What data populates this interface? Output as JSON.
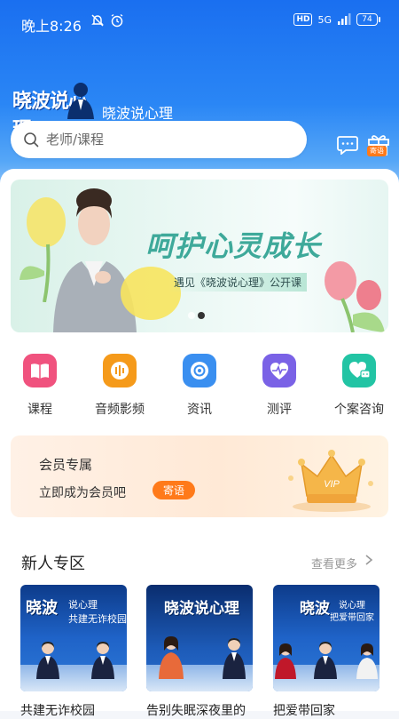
{
  "status_bar": {
    "time": "晚上8:26",
    "hd": "HD",
    "signal": "5G",
    "battery": "74"
  },
  "brand": {
    "logo_text": "晓波说心理",
    "name": "晓波说心理"
  },
  "search": {
    "placeholder": "老师/课程"
  },
  "header_icons": {
    "gift_tag": "寄语"
  },
  "banner": {
    "title": "呵护心灵成长",
    "subtitle": "遇见《晓波说心理》公开课",
    "dot_count": 2,
    "active_index": 1
  },
  "categories": [
    {
      "label": "课程",
      "icon": "book-icon",
      "color": "#f0527e"
    },
    {
      "label": "音频影频",
      "icon": "audio-icon",
      "color": "#f59a1a"
    },
    {
      "label": "资讯",
      "icon": "camera-icon",
      "color": "#3a8ff0"
    },
    {
      "label": "测评",
      "icon": "heart-pulse-icon",
      "color": "#7a62e6"
    },
    {
      "label": "个案咨询",
      "icon": "heart-chat-icon",
      "color": "#22c4a4"
    }
  ],
  "member": {
    "title": "会员专属",
    "subtitle": "立即成为会员吧",
    "button": "寄语",
    "badge": "VIP"
  },
  "new_user": {
    "title": "新人专区",
    "more": "查看更多",
    "videos": [
      {
        "caption": "共建无诈校园",
        "title": "晓波",
        "sub1": "说心理",
        "sub2": "共建无诈校园"
      },
      {
        "caption": "告别失眠深夜里的",
        "title": "晓波说心理",
        "sub1": "",
        "sub2": ""
      },
      {
        "caption": "把爱带回家",
        "title": "晓波",
        "sub1": "说心理",
        "sub2": "把爱带回家"
      }
    ]
  },
  "colors": {
    "header_blue": "#1a6ff0",
    "accent_orange": "#ff7a1a"
  }
}
